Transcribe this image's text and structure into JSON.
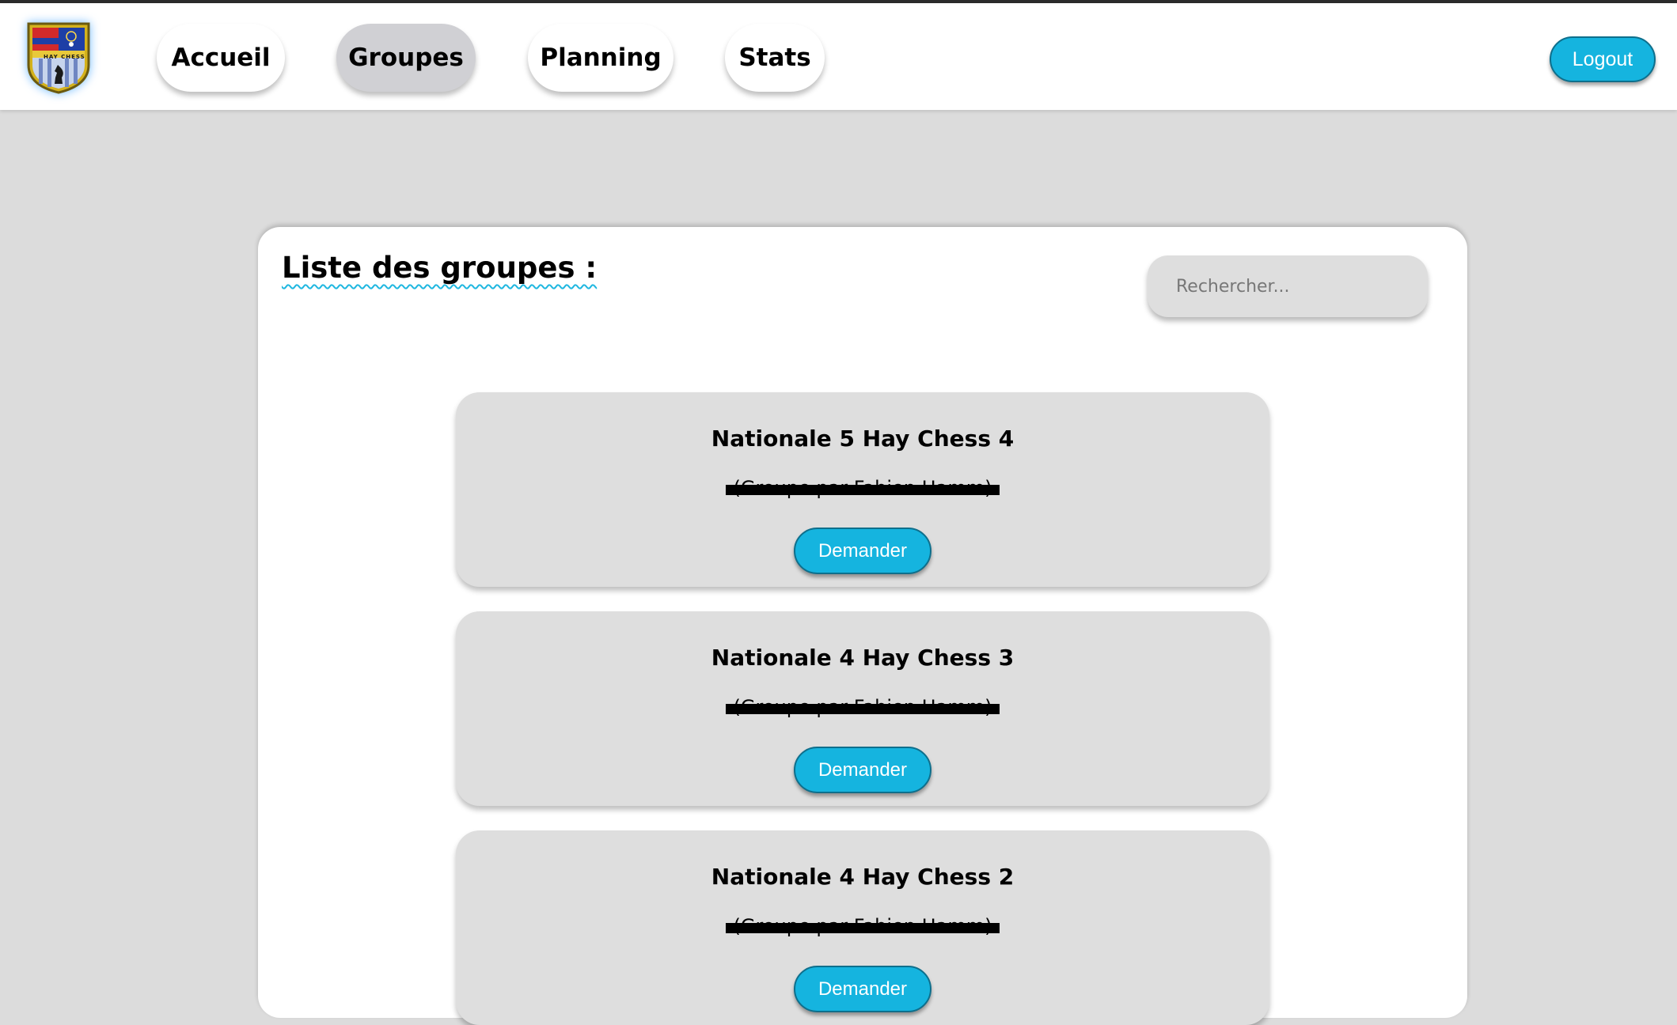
{
  "nav": {
    "logo_text": "HAY CHESS",
    "items": [
      {
        "label": "Accueil",
        "active": false
      },
      {
        "label": "Groupes",
        "active": true
      },
      {
        "label": "Planning",
        "active": false
      },
      {
        "label": "Stats",
        "active": false
      }
    ],
    "logout_label": "Logout"
  },
  "panel": {
    "title": "Liste des groupes :",
    "search_placeholder": "Rechercher..."
  },
  "groups": [
    {
      "title": "Nationale 5 Hay Chess 4",
      "subtitle": "(Groupe par Fabien Hamm)",
      "action": "Demander"
    },
    {
      "title": "Nationale 4 Hay Chess 3",
      "subtitle": "(Groupe par Fabien Hamm)",
      "action": "Demander"
    },
    {
      "title": "Nationale 4 Hay Chess 2",
      "subtitle": "(Groupe par Fabien Hamm)",
      "action": "Demander"
    }
  ],
  "colors": {
    "accent": "#15b4df",
    "accent_border": "#0e6f8c",
    "background": "#dcdcdc",
    "card": "#dedede",
    "active_nav": "#d0d0d4"
  }
}
